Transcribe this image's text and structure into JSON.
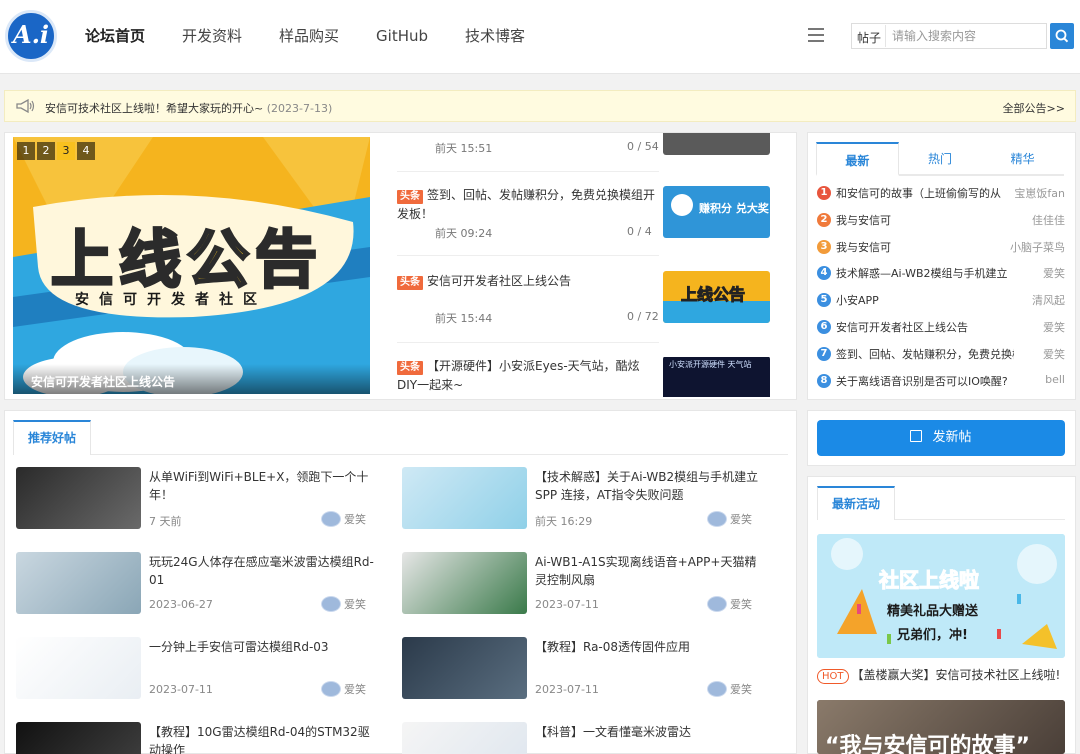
{
  "header": {
    "logo_text": "A.i",
    "nav": [
      "论坛首页",
      "开发资料",
      "样品购买",
      "GitHub",
      "技术博客"
    ],
    "search": {
      "type": "帖子",
      "placeholder": "请输入搜索内容"
    }
  },
  "notice": {
    "text": "安信可技术社区上线啦！希望大家玩的开心~",
    "date": "(2023-7-13)",
    "all_link": "全部公告>>"
  },
  "slider": {
    "numbers": [
      "1",
      "2",
      "3",
      "4"
    ],
    "active_index": 3,
    "caption": "安信可开发者社区上线公告",
    "banner_title": "上线公告",
    "banner_sub": "安信可开发者社区"
  },
  "news": {
    "top_partial": {
      "time": "前天 15:51",
      "count": "0 / 54"
    },
    "items": [
      {
        "badge": "头条",
        "title": "签到、回帖、发帖赚积分，免费兑换模组开发板！",
        "time": "前天 09:24",
        "count": "0 / 4",
        "thumb_text": "赚积分 兑大奖"
      },
      {
        "badge": "头条",
        "title": "安信可开发者社区上线公告",
        "time": "前天 15:44",
        "count": "0 / 72",
        "thumb_text": "上线公告"
      },
      {
        "badge": "头条",
        "title": "【开源硬件】小安派Eyes-天气站，酷炫DIY一起来~",
        "time": "",
        "count": "",
        "thumb_text": "小安派开源硬件 天气站"
      }
    ]
  },
  "ranking": {
    "tabs": [
      "最新",
      "热门",
      "精华"
    ],
    "items": [
      {
        "num": "1",
        "title": "和安信可的故事（上班偷偷写的从",
        "author": "宝崽饭fan",
        "color": "#e8553d"
      },
      {
        "num": "2",
        "title": "我与安信可",
        "author": "佳佳佳",
        "color": "#f07a3b"
      },
      {
        "num": "3",
        "title": "我与安信可",
        "author": "小脑子菜鸟",
        "color": "#f29b3a"
      },
      {
        "num": "4",
        "title": "技术解惑—Ai-WB2模组与手机建立",
        "author": "爱笑",
        "color": "#3b8fe0"
      },
      {
        "num": "5",
        "title": "小安APP",
        "author": "清风起",
        "color": "#3b8fe0"
      },
      {
        "num": "6",
        "title": "安信可开发者社区上线公告",
        "author": "爱笑",
        "color": "#3b8fe0"
      },
      {
        "num": "7",
        "title": "签到、回帖、发帖赚积分，免费兑换模",
        "author": "爱笑",
        "color": "#3b8fe0"
      },
      {
        "num": "8",
        "title": "关于离线语音识别是否可以IO唤醒?",
        "author": "bell",
        "color": "#3b8fe0"
      }
    ]
  },
  "recommended": {
    "tab": "推荐好帖",
    "items": [
      {
        "title": "从单WiFi到WiFi+BLE+X，领跑下一个十年！",
        "date": "7 天前",
        "author": "爱笑"
      },
      {
        "title": "【技术解惑】关于Ai-WB2模组与手机建立SPP 连接，AT指令失败问题",
        "date": "前天 16:29",
        "author": "爱笑"
      },
      {
        "title": "玩玩24G人体存在感应毫米波雷达模组Rd-01",
        "date": "2023-06-27",
        "author": "爱笑"
      },
      {
        "title": "Ai-WB1-A1S实现离线语音+APP+天猫精灵控制风扇",
        "date": "2023-07-11",
        "author": "爱笑"
      },
      {
        "title": "一分钟上手安信可雷达模组Rd-03",
        "date": "2023-07-11",
        "author": "爱笑"
      },
      {
        "title": "【教程】Ra-08透传固件应用",
        "date": "2023-07-11",
        "author": "爱笑"
      },
      {
        "title": "【教程】10G雷达模组Rd-04的STM32驱动操作",
        "date": "",
        "author": ""
      },
      {
        "title": "【科普】一文看懂毫米波雷达",
        "date": "",
        "author": ""
      }
    ]
  },
  "sidebar": {
    "post_button": "发新帖",
    "activity_tab": "最新活动",
    "activity_banner_title": "社区上线啦",
    "activity_banner_sub1": "精美礼品大赠送",
    "activity_banner_sub2": "兄弟们，冲!",
    "activity_hot": "HOT",
    "activity_text": "【盖楼赢大奖】安信可技术社区上线啦!",
    "activity2_text": "“我与安信可的故事”"
  }
}
